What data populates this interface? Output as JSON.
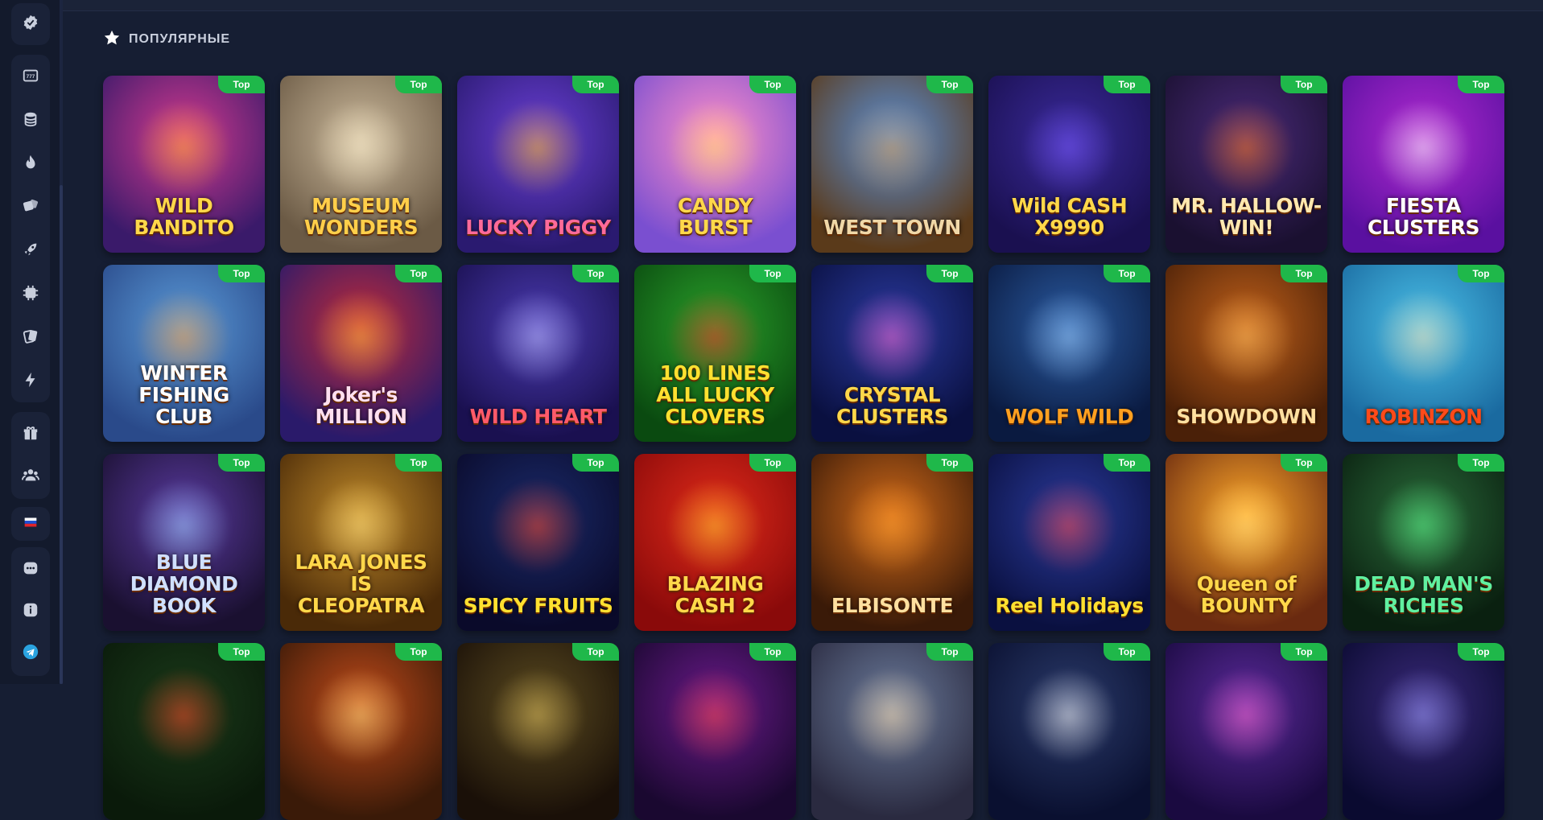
{
  "section": {
    "title": "ПОПУЛЯРНЫЕ",
    "icon": "star-icon"
  },
  "badge_label": "Top",
  "sidebar": {
    "items": [
      {
        "icon": "shield-check-icon"
      },
      {
        "icon": "slot-machine-icon"
      },
      {
        "icon": "coins-stack-icon"
      },
      {
        "icon": "fire-icon"
      },
      {
        "icon": "dice-icon"
      },
      {
        "icon": "rocket-icon"
      },
      {
        "icon": "chip-icon"
      },
      {
        "icon": "cards-icon"
      },
      {
        "icon": "lightning-icon"
      },
      {
        "icon": "gift-icon"
      },
      {
        "icon": "users-icon"
      },
      {
        "icon": "russia-flag-icon"
      },
      {
        "icon": "chat-dots-icon"
      },
      {
        "icon": "info-icon"
      },
      {
        "icon": "telegram-icon"
      }
    ]
  },
  "games": [
    {
      "title": "WILD BANDITO",
      "bg1": "#d43a8f",
      "bg2": "#3a1a6a",
      "glow": "#ffb02e",
      "text": "#ffd84a"
    },
    {
      "title": "MUSEUM WONDERS",
      "bg1": "#c9b79a",
      "bg2": "#6b5a45",
      "glow": "#fff2d0",
      "text": "#ffcf4a"
    },
    {
      "title": "LUCKY PIGGY",
      "bg1": "#6a3fd6",
      "bg2": "#2a1a70",
      "glow": "#ffc21a",
      "text": "#ff6a9a"
    },
    {
      "title": "CANDY BURST",
      "bg1": "#ff8fc8",
      "bg2": "#7a4fd0",
      "glow": "#ffe06a",
      "text": "#ffd84a"
    },
    {
      "title": "WEST TOWN",
      "bg1": "#5a8fd6",
      "bg2": "#5a3a1a",
      "glow": "#e0a050",
      "text": "#f0d8a8"
    },
    {
      "title": "Wild CASH X9990",
      "bg1": "#3a2a9a",
      "bg2": "#1a1050",
      "glow": "#7a5aff",
      "text": "#ffd84a"
    },
    {
      "title": "MR. HALLOW-WIN!",
      "bg1": "#4a2a7a",
      "bg2": "#1a1030",
      "glow": "#ff7a1a",
      "text": "#ffe8b0"
    },
    {
      "title": "FIESTA CLUSTERS",
      "bg1": "#b02ad0",
      "bg2": "#5a10a0",
      "glow": "#ffffff",
      "text": "#ffffff"
    },
    {
      "title": "WINTER FISHING CLUB",
      "bg1": "#5a9ad8",
      "bg2": "#2a4a8a",
      "glow": "#ffa040",
      "text": "#ffffff"
    },
    {
      "title": "Joker's MILLION",
      "bg1": "#c02a3a",
      "bg2": "#2a1a6a",
      "glow": "#ffc040",
      "text": "#ffe0f0"
    },
    {
      "title": "WILD HEART",
      "bg1": "#4a3ab0",
      "bg2": "#1a1050",
      "glow": "#c0c0ff",
      "text": "#ff5a6a"
    },
    {
      "title": "100 LINES ALL LUCKY CLOVERS",
      "bg1": "#2aa02a",
      "bg2": "#0a4a10",
      "glow": "#ff2a2a",
      "text": "#ffe030"
    },
    {
      "title": "CRYSTAL CLUSTERS",
      "bg1": "#2a3aa0",
      "bg2": "#0a1040",
      "glow": "#ff6ad0",
      "text": "#ffd84a"
    },
    {
      "title": "WOLF WILD",
      "bg1": "#2a5aa0",
      "bg2": "#0a1a40",
      "glow": "#a0d0ff",
      "text": "#ffa020"
    },
    {
      "title": "SHOWDOWN",
      "bg1": "#c0601a",
      "bg2": "#4a2008",
      "glow": "#ffc060",
      "text": "#ffe0a0"
    },
    {
      "title": "ROBINZON",
      "bg1": "#4ac0e8",
      "bg2": "#1a6aa0",
      "glow": "#ffe0b0",
      "text": "#ff4a1a"
    },
    {
      "title": "BLUE DIAMOND BOOK",
      "bg1": "#5a3aa0",
      "bg2": "#1a1030",
      "glow": "#a0d0ff",
      "text": "#d0e0ff"
    },
    {
      "title": "LARA JONES IS CLEOPATRA",
      "bg1": "#c08a2a",
      "bg2": "#4a2a08",
      "glow": "#ffe080",
      "text": "#ffd84a"
    },
    {
      "title": "SPICY FRUITS",
      "bg1": "#1a2a6a",
      "bg2": "#0a0a2a",
      "glow": "#ff4a2a",
      "text": "#ffe030"
    },
    {
      "title": "BLAZING CASH 2",
      "bg1": "#e02a1a",
      "bg2": "#8a0a0a",
      "glow": "#ffd030",
      "text": "#ffd84a"
    },
    {
      "title": "ELBISONTE",
      "bg1": "#d06a1a",
      "bg2": "#3a1a08",
      "glow": "#ffa030",
      "text": "#ffe0a0"
    },
    {
      "title": "Reel Holidays",
      "bg1": "#2a3a9a",
      "bg2": "#0a1040",
      "glow": "#ff4a4a",
      "text": "#ffe030"
    },
    {
      "title": "Queen of BOUNTY",
      "bg1": "#ffa82a",
      "bg2": "#6a2a10",
      "glow": "#ffe080",
      "text": "#ffd84a"
    },
    {
      "title": "DEAD MAN'S RICHES",
      "bg1": "#2a6a3a",
      "bg2": "#0a2010",
      "glow": "#60ff90",
      "text": "#60f0a0"
    },
    {
      "title": "",
      "bg1": "#1a3a1a",
      "bg2": "#0a1a0a",
      "glow": "#ff4a2a",
      "text": "#ffd84a"
    },
    {
      "title": "",
      "bg1": "#c04a1a",
      "bg2": "#3a1a08",
      "glow": "#ffe080",
      "text": "#ffd84a"
    },
    {
      "title": "",
      "bg1": "#5a4a20",
      "bg2": "#1a1008",
      "glow": "#e0c060",
      "text": "#ffd84a"
    },
    {
      "title": "",
      "bg1": "#6a1a8a",
      "bg2": "#1a0830",
      "glow": "#ff4a4a",
      "text": "#ffd84a"
    },
    {
      "title": "",
      "bg1": "#6a7a9a",
      "bg2": "#2a2a40",
      "glow": "#ffe0b0",
      "text": "#ffd84a"
    },
    {
      "title": "",
      "bg1": "#2a3a6a",
      "bg2": "#0a1030",
      "glow": "#ffffff",
      "text": "#ffd84a"
    },
    {
      "title": "",
      "bg1": "#5a2a9a",
      "bg2": "#1a0a40",
      "glow": "#ff6ad0",
      "text": "#ffd84a"
    },
    {
      "title": "",
      "bg1": "#3a2a7a",
      "bg2": "#0a0a30",
      "glow": "#a0a0ff",
      "text": "#ffd84a"
    }
  ]
}
